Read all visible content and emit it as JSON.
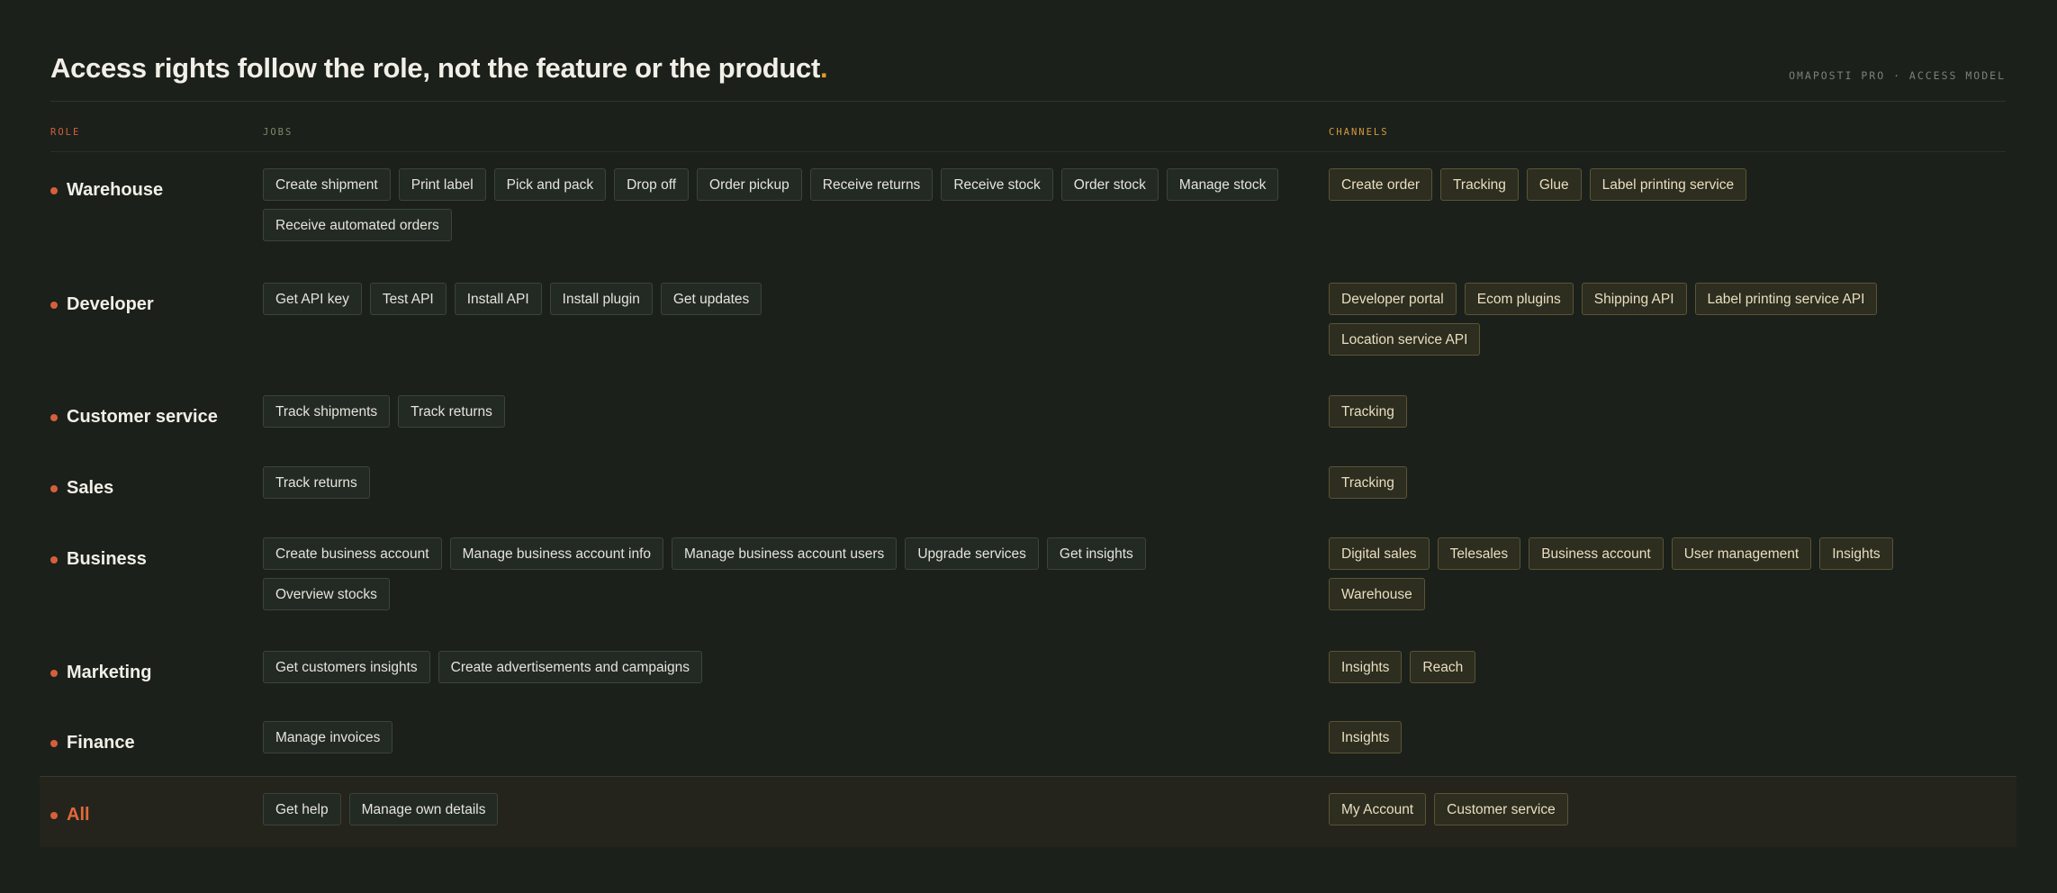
{
  "header": {
    "title": "Access rights follow the role, not the feature or the product",
    "title_dot": ".",
    "eyebrow": "OMAPOSTI PRO · ACCESS MODEL"
  },
  "columns": {
    "role": "ROLE",
    "jobs": "JOBS",
    "channels": "CHANNELS"
  },
  "colors": {
    "background": "#1b201b",
    "role_accent": "#d4603a",
    "channel_accent": "#d49a3a",
    "title_dot": "#e09a2a"
  },
  "rows": [
    {
      "role": "Warehouse",
      "jobs": [
        "Create shipment",
        "Print label",
        "Pick and pack",
        "Drop off",
        "Order pickup",
        "Receive returns",
        "Receive stock",
        "Order stock",
        "Manage stock",
        "Receive automated orders"
      ],
      "channels": [
        "Create order",
        "Tracking",
        "Glue",
        "Label printing service"
      ]
    },
    {
      "role": "Developer",
      "jobs": [
        "Get API key",
        "Test API",
        "Install API",
        "Install plugin",
        "Get updates"
      ],
      "channels": [
        "Developer portal",
        "Ecom plugins",
        "Shipping API",
        "Label printing service API",
        "Location service API"
      ]
    },
    {
      "role": "Customer service",
      "jobs": [
        "Track shipments",
        "Track returns"
      ],
      "channels": [
        "Tracking"
      ]
    },
    {
      "role": "Sales",
      "jobs": [
        "Track returns"
      ],
      "channels": [
        "Tracking"
      ]
    },
    {
      "role": "Business",
      "jobs": [
        "Create business account",
        "Manage business account info",
        "Manage business account users",
        "Upgrade services",
        "Get insights",
        "Overview stocks"
      ],
      "channels": [
        "Digital sales",
        "Telesales",
        "Business account",
        "User management",
        "Insights",
        "Warehouse"
      ]
    },
    {
      "role": "Marketing",
      "jobs": [
        "Get customers insights",
        "Create advertisements and campaigns"
      ],
      "channels": [
        "Insights",
        "Reach"
      ]
    },
    {
      "role": "Finance",
      "jobs": [
        "Manage invoices"
      ],
      "channels": [
        "Insights"
      ]
    },
    {
      "role": "All",
      "jobs": [
        "Get help",
        "Manage own details"
      ],
      "channels": [
        "My Account",
        "Customer service"
      ]
    }
  ]
}
